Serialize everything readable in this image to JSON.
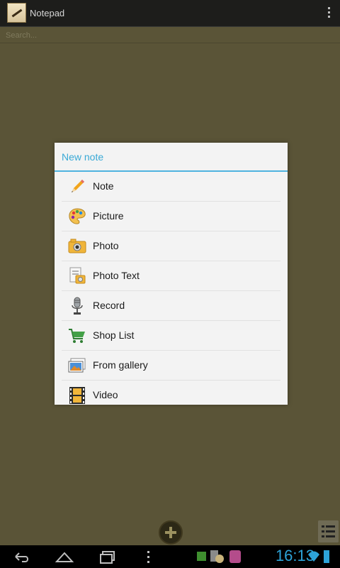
{
  "app": {
    "title": "Notepad",
    "search_placeholder": "Search..."
  },
  "dialog": {
    "title": "New note",
    "items": [
      {
        "label": "Note",
        "icon": "pencil-icon"
      },
      {
        "label": "Picture",
        "icon": "palette-icon"
      },
      {
        "label": "Photo",
        "icon": "camera-icon"
      },
      {
        "label": "Photo Text",
        "icon": "photo-text-icon"
      },
      {
        "label": "Record",
        "icon": "microphone-icon"
      },
      {
        "label": "Shop List",
        "icon": "cart-icon"
      },
      {
        "label": "From gallery",
        "icon": "gallery-icon"
      },
      {
        "label": "Video",
        "icon": "film-icon"
      }
    ]
  },
  "status": {
    "time": "16:13"
  },
  "colors": {
    "background": "#5a5437",
    "dialog_title": "#39a9d6",
    "accent_line": "#4fb3df"
  }
}
